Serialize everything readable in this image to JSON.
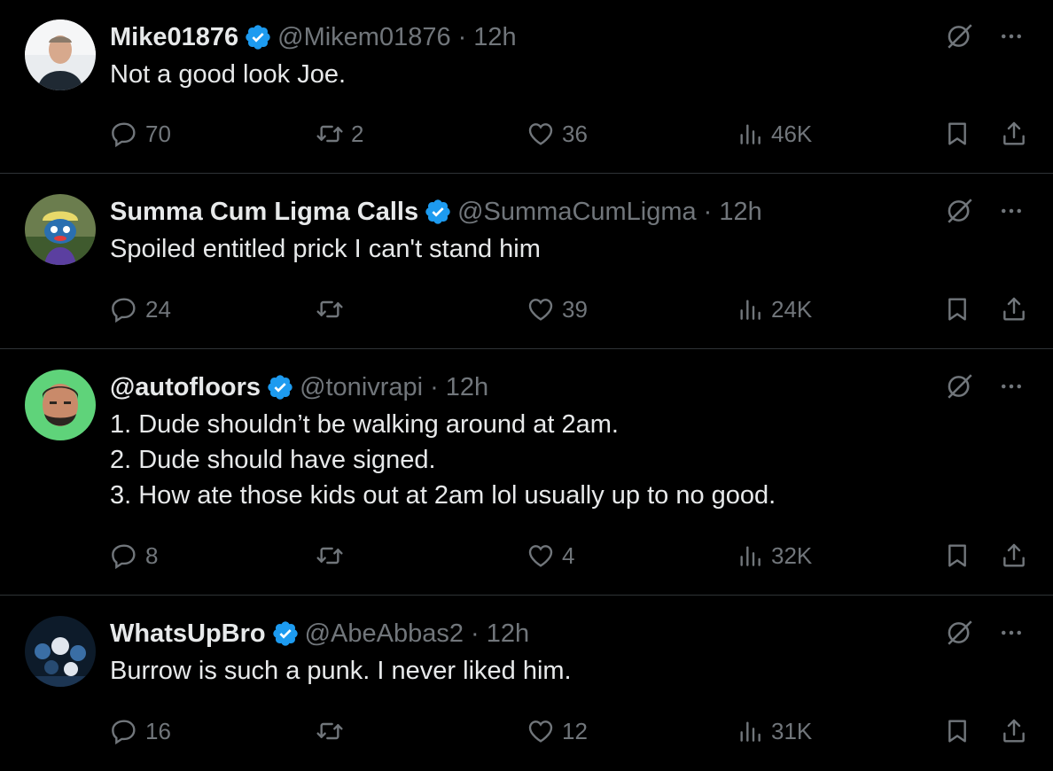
{
  "colors": {
    "background": "#000000",
    "text": "#e7e9ea",
    "muted": "#71767b",
    "verified": "#1d9bf0",
    "divider": "#2f3336"
  },
  "tweets": [
    {
      "name": "Mike01876",
      "handle": "@Mikem01876",
      "time": "12h",
      "text": "Not a good look Joe.",
      "replies": "70",
      "retweets": "2",
      "likes": "36",
      "views": "46K"
    },
    {
      "name": "Summa Cum Ligma Calls",
      "handle": "@SummaCumLigma",
      "time": "12h",
      "text": "Spoiled entitled prick I can't stand him",
      "replies": "24",
      "retweets": "",
      "likes": "39",
      "views": "24K"
    },
    {
      "name": "@autofloors",
      "handle": "@tonivrapi",
      "time": "12h",
      "text": "1. Dude shouldn’t be walking around at 2am.\n2. Dude should have signed.\n3. How ate those kids out at 2am lol usually up to no good.",
      "replies": "8",
      "retweets": "",
      "likes": "4",
      "views": "32K"
    },
    {
      "name": "WhatsUpBro",
      "handle": "@AbeAbbas2",
      "time": "12h",
      "text": "Burrow is such a punk. I never liked him.",
      "replies": "16",
      "retweets": "",
      "likes": "12",
      "views": "31K"
    }
  ],
  "icons": {
    "verified": "verified-badge-icon",
    "grok": "grok-icon",
    "more": "more-icon",
    "reply": "reply-icon",
    "retweet": "retweet-icon",
    "like": "heart-icon",
    "views": "views-icon",
    "bookmark": "bookmark-icon",
    "share": "share-icon"
  }
}
